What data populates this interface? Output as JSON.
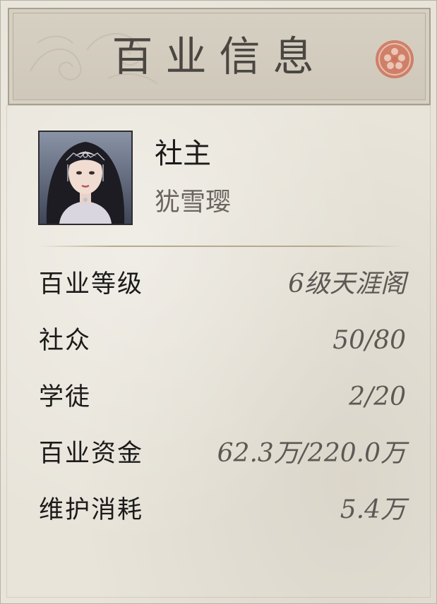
{
  "header": {
    "title": "百业信息",
    "seal_icon": "red-seal-icon"
  },
  "profile": {
    "role": "社主",
    "name": "犹雪璎",
    "avatar_icon": "character-portrait"
  },
  "stats": [
    {
      "label": "百业等级",
      "value": "6级天涯阁"
    },
    {
      "label": "社众",
      "value": "50/80"
    },
    {
      "label": "学徒",
      "value": "2/20"
    },
    {
      "label": "百业资金",
      "value": "62.3万/220.0万"
    },
    {
      "label": "维护消耗",
      "value": "5.4万"
    }
  ],
  "colors": {
    "paper": "#e8e4da",
    "header_bg": "#d3cdbf",
    "seal_red": "#c9614a",
    "text_dark": "#1c1b1a",
    "text_muted": "#5c5955"
  }
}
